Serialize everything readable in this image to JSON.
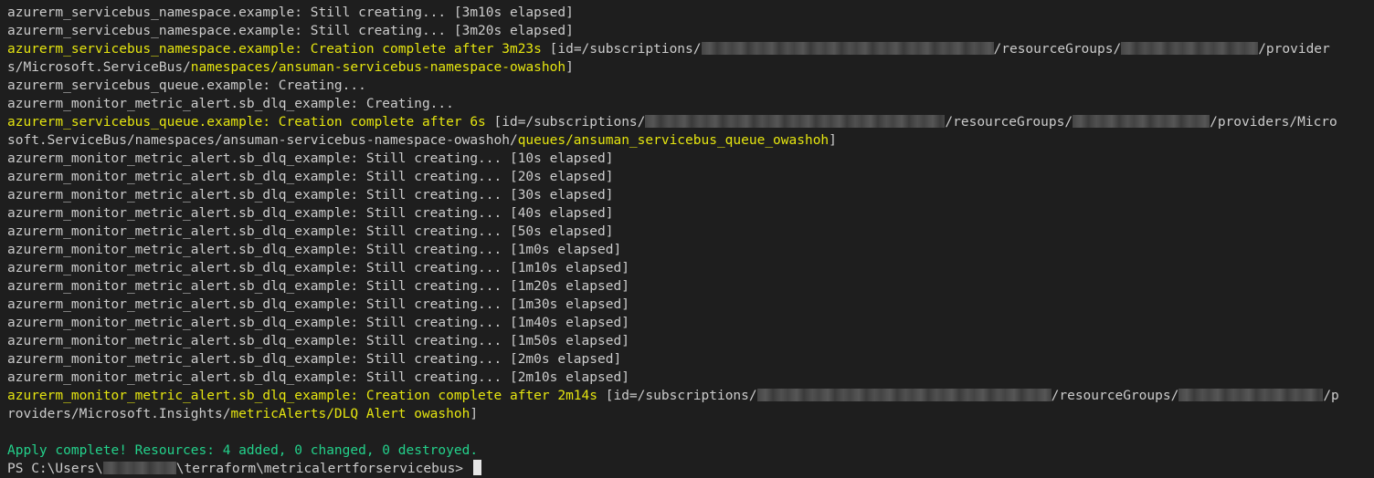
{
  "terminal": {
    "lines": [
      [
        {
          "t": "azurerm_servicebus_namespace.example: Still creating... [3m10s elapsed]",
          "c": "white"
        }
      ],
      [
        {
          "t": "azurerm_servicebus_namespace.example: Still creating... [3m20s elapsed]",
          "c": "white"
        }
      ],
      [
        {
          "t": "azurerm_servicebus_namespace.example: Creation complete after 3m23s",
          "c": "yellow"
        },
        {
          "t": " [id=/subscriptions/",
          "c": "white"
        },
        {
          "redact": true,
          "w": 320
        },
        {
          "t": "/resourceGroups/",
          "c": "white"
        },
        {
          "redact": true,
          "w": 150
        },
        {
          "t": "/provider",
          "c": "white"
        }
      ],
      [
        {
          "t": "s/Microsoft.ServiceBus/",
          "c": "white"
        },
        {
          "t": "namespaces/ansuman-servicebus-namespace-owashoh",
          "c": "yellow"
        },
        {
          "t": "]",
          "c": "white"
        }
      ],
      [
        {
          "t": "azurerm_servicebus_queue.example: Creating...",
          "c": "white"
        }
      ],
      [
        {
          "t": "azurerm_monitor_metric_alert.sb_dlq_example: Creating...",
          "c": "white"
        }
      ],
      [
        {
          "t": "azurerm_servicebus_queue.example: Creation complete after 6s",
          "c": "yellow"
        },
        {
          "t": " [id=/subscriptions/",
          "c": "white"
        },
        {
          "redact": true,
          "w": 328
        },
        {
          "t": "/resourceGroups/",
          "c": "white"
        },
        {
          "redact": true,
          "w": 150
        },
        {
          "t": "/providers/Micro",
          "c": "white"
        }
      ],
      [
        {
          "t": "soft.ServiceBus/namespaces/ansuman-servicebus-namespace-owashoh/",
          "c": "white"
        },
        {
          "t": "queues/ansuman_servicebus_queue_owashoh",
          "c": "yellow"
        },
        {
          "t": "]",
          "c": "white"
        }
      ],
      [
        {
          "t": "azurerm_monitor_metric_alert.sb_dlq_example: Still creating... [10s elapsed]",
          "c": "white"
        }
      ],
      [
        {
          "t": "azurerm_monitor_metric_alert.sb_dlq_example: Still creating... [20s elapsed]",
          "c": "white"
        }
      ],
      [
        {
          "t": "azurerm_monitor_metric_alert.sb_dlq_example: Still creating... [30s elapsed]",
          "c": "white"
        }
      ],
      [
        {
          "t": "azurerm_monitor_metric_alert.sb_dlq_example: Still creating... [40s elapsed]",
          "c": "white"
        }
      ],
      [
        {
          "t": "azurerm_monitor_metric_alert.sb_dlq_example: Still creating... [50s elapsed]",
          "c": "white"
        }
      ],
      [
        {
          "t": "azurerm_monitor_metric_alert.sb_dlq_example: Still creating... [1m0s elapsed]",
          "c": "white"
        }
      ],
      [
        {
          "t": "azurerm_monitor_metric_alert.sb_dlq_example: Still creating... [1m10s elapsed]",
          "c": "white"
        }
      ],
      [
        {
          "t": "azurerm_monitor_metric_alert.sb_dlq_example: Still creating... [1m20s elapsed]",
          "c": "white"
        }
      ],
      [
        {
          "t": "azurerm_monitor_metric_alert.sb_dlq_example: Still creating... [1m30s elapsed]",
          "c": "white"
        }
      ],
      [
        {
          "t": "azurerm_monitor_metric_alert.sb_dlq_example: Still creating... [1m40s elapsed]",
          "c": "white"
        }
      ],
      [
        {
          "t": "azurerm_monitor_metric_alert.sb_dlq_example: Still creating... [1m50s elapsed]",
          "c": "white"
        }
      ],
      [
        {
          "t": "azurerm_monitor_metric_alert.sb_dlq_example: Still creating... [2m0s elapsed]",
          "c": "white"
        }
      ],
      [
        {
          "t": "azurerm_monitor_metric_alert.sb_dlq_example: Still creating... [2m10s elapsed]",
          "c": "white"
        }
      ],
      [
        {
          "t": "azurerm_monitor_metric_alert.sb_dlq_example: Creation complete after 2m14s",
          "c": "yellow"
        },
        {
          "t": " [id=/subscriptions/",
          "c": "white"
        },
        {
          "redact": true,
          "w": 322
        },
        {
          "t": "/resourceGroups/",
          "c": "white"
        },
        {
          "redact": true,
          "w": 158
        },
        {
          "t": "/p",
          "c": "white"
        }
      ],
      [
        {
          "t": "roviders/Microsoft.Insights/",
          "c": "white"
        },
        {
          "t": "metricAlerts/DLQ Alert owashoh",
          "c": "yellow"
        },
        {
          "t": "]",
          "c": "white"
        }
      ],
      [],
      [
        {
          "t": "Apply complete! Resources: 4 added, 0 changed, 0 destroyed.",
          "c": "green"
        }
      ],
      [
        {
          "t": "PS C:\\Users\\",
          "c": "white"
        },
        {
          "redact": true,
          "w": 80
        },
        {
          "t": "\\terraform\\metricalertforservicebus> ",
          "c": "white"
        },
        {
          "cursor": true
        }
      ]
    ]
  }
}
